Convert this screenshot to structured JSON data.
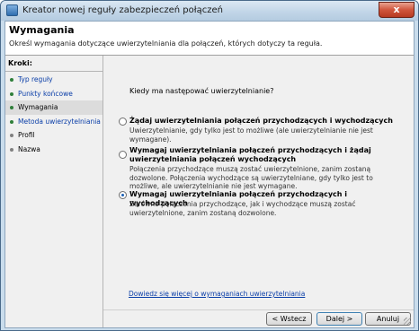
{
  "window": {
    "title": "Kreator nowej reguły zabezpieczeń połączeń",
    "close_label": "x"
  },
  "header": {
    "title": "Wymagania",
    "description": "Określ wymagania dotyczące uwierzytelniania dla połączeń, których dotyczy ta reguła."
  },
  "steps": {
    "title": "Kroki:",
    "items": [
      {
        "label": "Typ reguły",
        "state": "link"
      },
      {
        "label": "Punkty końcowe",
        "state": "link"
      },
      {
        "label": "Wymagania",
        "state": "current"
      },
      {
        "label": "Metoda uwierzytelniania",
        "state": "link"
      },
      {
        "label": "Profil",
        "state": "plain"
      },
      {
        "label": "Nazwa",
        "state": "plain"
      }
    ]
  },
  "content": {
    "question": "Kiedy ma następować uwierzytelnianie?",
    "options": [
      {
        "label": "Żądaj uwierzytelniania połączeń przychodzących i wychodzących",
        "description": "Uwierzytelnianie, gdy tylko jest to możliwe (ale uwierzytelnianie nie jest wymagane).",
        "selected": false
      },
      {
        "label": "Wymagaj uwierzytelniania połączeń przychodzących i żądaj uwierzytelniania połączeń wychodzących",
        "description": "Połączenia przychodzące muszą zostać uwierzytelnione, zanim zostaną dozwolone. Połączenia wychodzące są uwierzytelniane, gdy tylko jest to możliwe, ale uwierzytelnianie nie jest wymagane.",
        "selected": false
      },
      {
        "label": "Wymagaj uwierzytelniania połączeń przychodzących i wychodzących",
        "description": "Zarówno połączenia przychodzące, jak i wychodzące muszą zostać uwierzytelnione, zanim zostaną dozwolone.",
        "selected": true
      }
    ],
    "learn_more": "Dowiedz się więcej o wymaganiach uwierzytelniania"
  },
  "buttons": {
    "back": "< Wstecz",
    "next": "Dalej >",
    "cancel": "Anuluj"
  }
}
